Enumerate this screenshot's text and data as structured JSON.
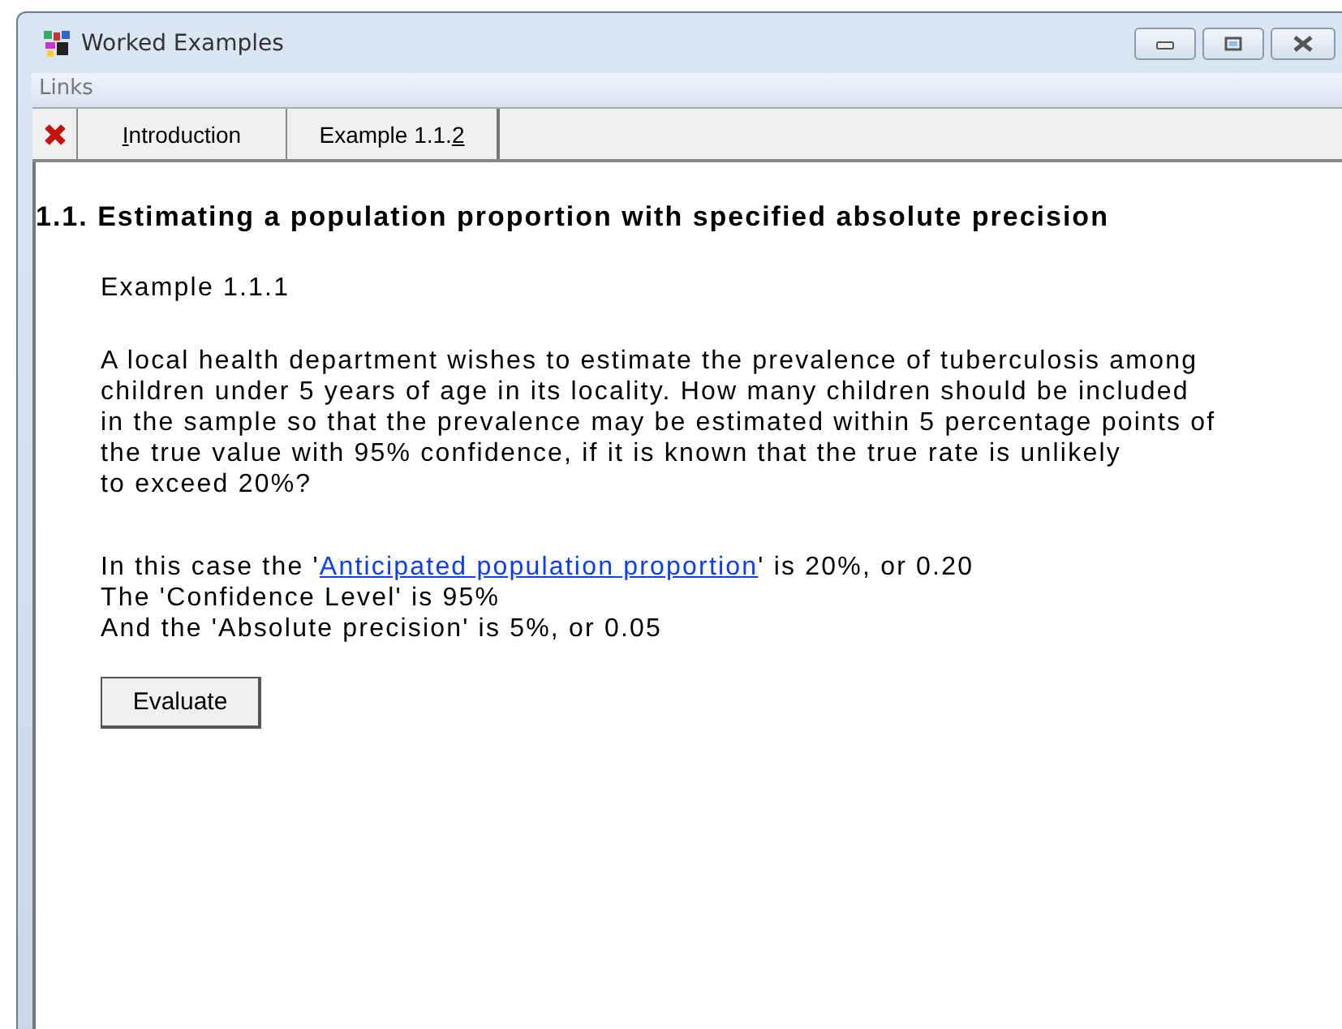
{
  "window": {
    "title": "Worked Examples"
  },
  "menu": [
    "Links"
  ],
  "toolbar": {
    "tabs": [
      {
        "key": "I",
        "after": "ntroduction"
      },
      {
        "before": "Example 1.1.",
        "key": "2"
      }
    ]
  },
  "content": {
    "heading": "1.1. Estimating a population proportion with specified absolute precision",
    "example_title": "Example 1.1.1",
    "paragraph_lines": [
      "A local health department wishes to estimate the prevalence of tuberculosis among",
      "children under 5 years of age in its locality. How many children should be included",
      "in the sample so that the prevalence may be estimated within 5 percentage points of",
      "the true value with 95% confidence, if it is known that the true rate is unlikely",
      "to exceed 20%?"
    ],
    "case_line": {
      "before": "In this case the '",
      "link": "Anticipated population proportion",
      "after": "' is 20%, or 0.20"
    },
    "lines": [
      "The 'Confidence Level' is 95%",
      "And the 'Absolute precision' is 5%, or 0.05"
    ],
    "button": "Evaluate"
  }
}
